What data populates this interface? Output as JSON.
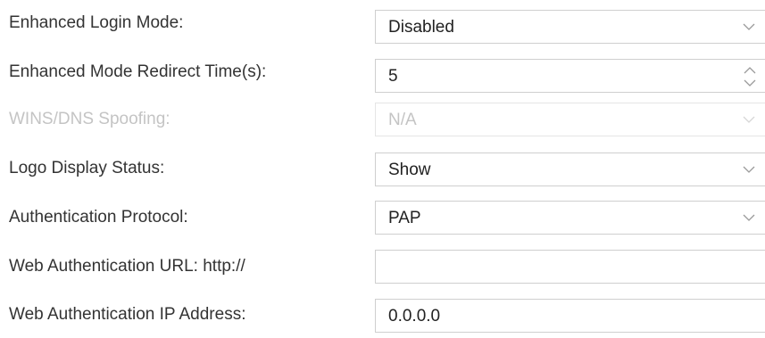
{
  "form": {
    "rows": [
      {
        "label": "Enhanced Login Mode:",
        "value": "Disabled",
        "control": "select",
        "icon": "chevron-down-icon",
        "enabled": true
      },
      {
        "label": "Enhanced Mode Redirect Time(s):",
        "value": "5",
        "control": "spinner",
        "icon": "spinner-arrows-icon",
        "enabled": true
      },
      {
        "label": "WINS/DNS Spoofing:",
        "value": "N/A",
        "control": "select",
        "icon": "chevron-down-icon",
        "enabled": false
      },
      {
        "label": "Logo Display Status:",
        "value": "Show",
        "control": "select",
        "icon": "chevron-down-icon",
        "enabled": true
      },
      {
        "label": "Authentication Protocol:",
        "value": "PAP",
        "control": "select",
        "icon": "chevron-down-icon",
        "enabled": true
      },
      {
        "label": "Web Authentication URL: http://",
        "value": "",
        "control": "text",
        "enabled": true
      },
      {
        "label": "Web Authentication IP Address:",
        "value": "0.0.0.0",
        "control": "text",
        "enabled": true
      }
    ]
  },
  "colors": {
    "text": "#333333",
    "disabled_text": "#c4c4c4",
    "border": "#cfcfcf",
    "disabled_border": "#e5e5e5",
    "icon": "#9a9a9a"
  }
}
